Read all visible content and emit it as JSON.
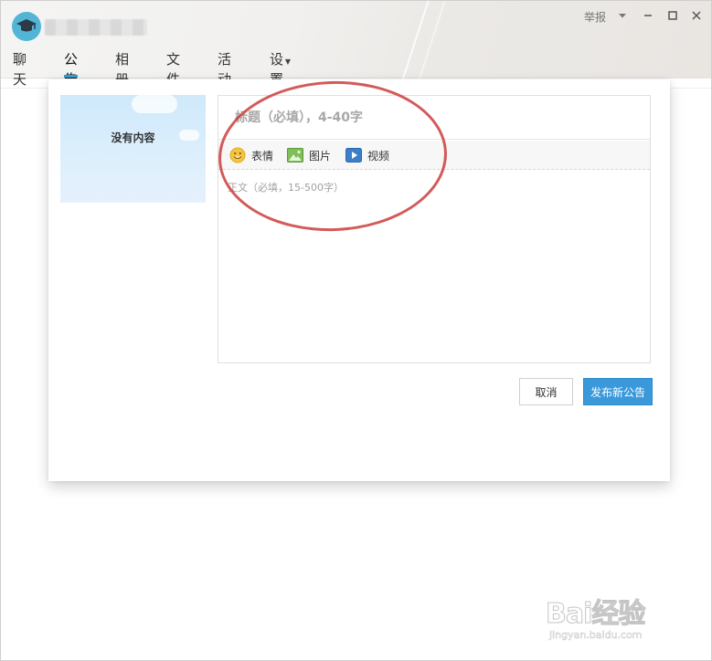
{
  "window": {
    "report_label": "举报",
    "colors": {
      "accent": "#2d9fd8",
      "publish_button": "#3a99da",
      "annotation": "#cc3d3d"
    }
  },
  "tabs": [
    {
      "label": "聊天",
      "active": false
    },
    {
      "label": "公告",
      "active": true
    },
    {
      "label": "相册",
      "active": false
    },
    {
      "label": "文件",
      "active": false
    },
    {
      "label": "活动",
      "active": false
    },
    {
      "label": "设置",
      "active": false,
      "dropdown": true
    }
  ],
  "preview": {
    "empty_text": "没有内容"
  },
  "editor": {
    "title_placeholder": "标题（必填），4-40字",
    "body_placeholder": "正文（必填，15-500字）",
    "tools": [
      {
        "label": "表情",
        "icon": "emoji-icon"
      },
      {
        "label": "图片",
        "icon": "image-icon"
      },
      {
        "label": "视频",
        "icon": "video-icon"
      }
    ]
  },
  "actions": {
    "cancel_label": "取消",
    "publish_label": "发布新公告"
  },
  "watermark": {
    "main": "Bai经验",
    "sub": "jingyan.baidu.com"
  }
}
